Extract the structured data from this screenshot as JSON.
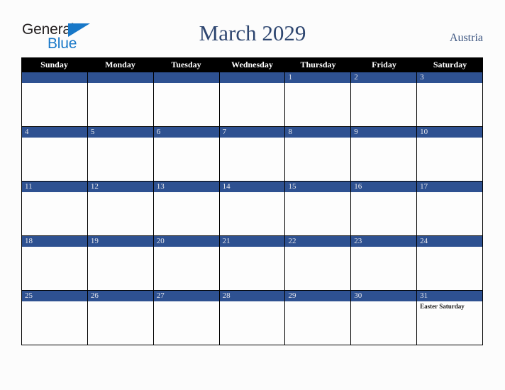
{
  "brand": {
    "name_dark": "General",
    "name_blue": "Blue",
    "triangle_icon": "triangle-icon",
    "dark_color": "#231f20",
    "blue_color": "#1878c8"
  },
  "header": {
    "title": "March 2029",
    "country": "Austria",
    "title_color": "#2e4670"
  },
  "theme": {
    "page_background": "#fcfcfc",
    "header_row_background": "#000000",
    "date_bar_color": "#2e5191",
    "date_number_color": "#e8e8ee",
    "cell_background": "#fdfdfd",
    "border_color": "#000000"
  },
  "calendar": {
    "month": "March",
    "year": "2029",
    "weekday_headers": [
      "Sunday",
      "Monday",
      "Tuesday",
      "Wednesday",
      "Thursday",
      "Friday",
      "Saturday"
    ],
    "weeks": [
      [
        {
          "num": "",
          "events": []
        },
        {
          "num": "",
          "events": []
        },
        {
          "num": "",
          "events": []
        },
        {
          "num": "",
          "events": []
        },
        {
          "num": "1",
          "events": []
        },
        {
          "num": "2",
          "events": []
        },
        {
          "num": "3",
          "events": []
        }
      ],
      [
        {
          "num": "4",
          "events": []
        },
        {
          "num": "5",
          "events": []
        },
        {
          "num": "6",
          "events": []
        },
        {
          "num": "7",
          "events": []
        },
        {
          "num": "8",
          "events": []
        },
        {
          "num": "9",
          "events": []
        },
        {
          "num": "10",
          "events": []
        }
      ],
      [
        {
          "num": "11",
          "events": []
        },
        {
          "num": "12",
          "events": []
        },
        {
          "num": "13",
          "events": []
        },
        {
          "num": "14",
          "events": []
        },
        {
          "num": "15",
          "events": []
        },
        {
          "num": "16",
          "events": []
        },
        {
          "num": "17",
          "events": []
        }
      ],
      [
        {
          "num": "18",
          "events": []
        },
        {
          "num": "19",
          "events": []
        },
        {
          "num": "20",
          "events": []
        },
        {
          "num": "21",
          "events": []
        },
        {
          "num": "22",
          "events": []
        },
        {
          "num": "23",
          "events": []
        },
        {
          "num": "24",
          "events": []
        }
      ],
      [
        {
          "num": "25",
          "events": []
        },
        {
          "num": "26",
          "events": []
        },
        {
          "num": "27",
          "events": []
        },
        {
          "num": "28",
          "events": []
        },
        {
          "num": "29",
          "events": []
        },
        {
          "num": "30",
          "events": []
        },
        {
          "num": "31",
          "events": [
            "Easter Saturday"
          ]
        }
      ]
    ]
  }
}
